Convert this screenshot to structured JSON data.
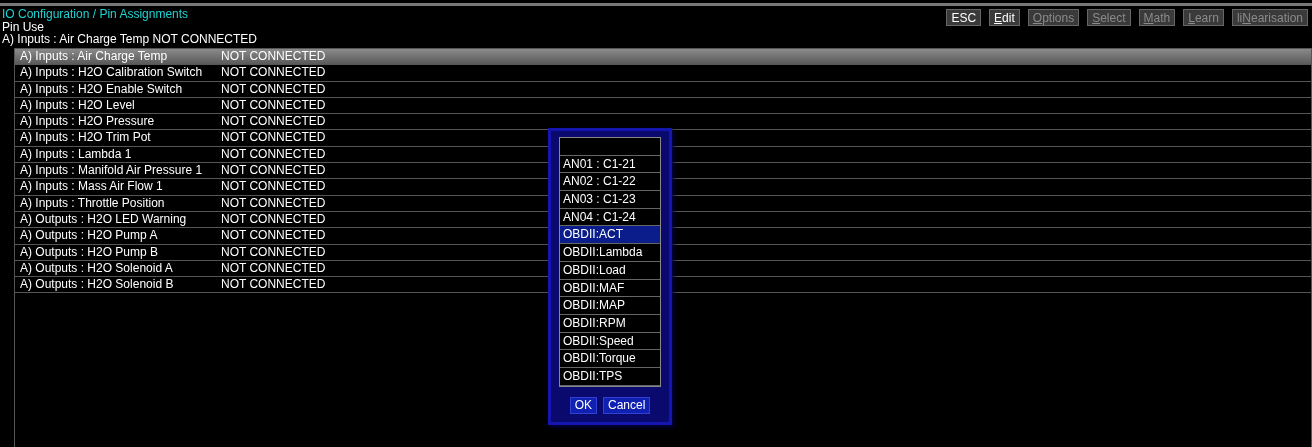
{
  "header": {
    "title": "IO Configuration / Pin Assignments",
    "section": "Pin Use",
    "current": "A) Inputs : Air Charge Temp  NOT CONNECTED"
  },
  "toolbar": [
    {
      "pre": "ESC",
      "disabled": false
    },
    {
      "key": "E",
      "post": "dit",
      "disabled": false
    },
    {
      "key": "O",
      "post": "ptions",
      "disabled": true
    },
    {
      "key": "S",
      "post": "elect",
      "disabled": true
    },
    {
      "key": "M",
      "post": "ath",
      "disabled": true
    },
    {
      "key": "L",
      "post": "earn",
      "disabled": true
    },
    {
      "pre": "li",
      "key": "N",
      "post": "earisation",
      "disabled": true
    }
  ],
  "pins": [
    {
      "name": "A) Inputs : Air Charge Temp",
      "state": "NOT CONNECTED",
      "selected": true
    },
    {
      "name": "A) Inputs : H2O Calibration Switch",
      "state": "NOT CONNECTED",
      "selected": false
    },
    {
      "name": "A) Inputs : H2O Enable Switch",
      "state": "NOT CONNECTED",
      "selected": false
    },
    {
      "name": "A) Inputs : H2O Level",
      "state": "NOT CONNECTED",
      "selected": false
    },
    {
      "name": "A) Inputs : H2O Pressure",
      "state": "NOT CONNECTED",
      "selected": false
    },
    {
      "name": "A) Inputs : H2O Trim Pot",
      "state": "NOT CONNECTED",
      "selected": false
    },
    {
      "name": "A) Inputs : Lambda 1",
      "state": "NOT CONNECTED",
      "selected": false
    },
    {
      "name": "A) Inputs : Manifold Air Pressure 1",
      "state": "NOT CONNECTED",
      "selected": false
    },
    {
      "name": "A) Inputs : Mass Air Flow 1",
      "state": "NOT CONNECTED",
      "selected": false
    },
    {
      "name": "A) Inputs : Throttle Position",
      "state": "NOT CONNECTED",
      "selected": false
    },
    {
      "name": "A) Outputs : H2O LED Warning",
      "state": "NOT CONNECTED",
      "selected": false
    },
    {
      "name": "A) Outputs : H2O Pump A",
      "state": "NOT CONNECTED",
      "selected": false
    },
    {
      "name": "A) Outputs : H2O Pump B",
      "state": "NOT CONNECTED",
      "selected": false
    },
    {
      "name": "A) Outputs : H2O Solenoid A",
      "state": "NOT CONNECTED",
      "selected": false
    },
    {
      "name": "A) Outputs : H2O Solenoid B",
      "state": "NOT CONNECTED",
      "selected": false
    }
  ],
  "popup": {
    "options": [
      {
        "kind": "blank",
        "selected": false
      },
      {
        "kind": "item",
        "label": "AN01 : C1-21",
        "selected": false
      },
      {
        "kind": "item",
        "label": "AN02 : C1-22",
        "selected": false
      },
      {
        "kind": "item",
        "label": "AN03 : C1-23",
        "selected": false
      },
      {
        "kind": "item",
        "label": "AN04 : C1-24",
        "selected": false
      },
      {
        "kind": "item",
        "label": "OBDII:ACT",
        "selected": true
      },
      {
        "kind": "item",
        "label": "OBDII:Lambda",
        "selected": false
      },
      {
        "kind": "item",
        "label": "OBDII:Load",
        "selected": false
      },
      {
        "kind": "item",
        "label": "OBDII:MAF",
        "selected": false
      },
      {
        "kind": "item",
        "label": "OBDII:MAP",
        "selected": false
      },
      {
        "kind": "item",
        "label": "OBDII:RPM",
        "selected": false
      },
      {
        "kind": "item",
        "label": "OBDII:Speed",
        "selected": false
      },
      {
        "kind": "item",
        "label": "OBDII:Torque",
        "selected": false
      },
      {
        "kind": "item",
        "label": "OBDII:TPS",
        "selected": false
      }
    ],
    "buttons": [
      "OK",
      "Cancel"
    ]
  }
}
